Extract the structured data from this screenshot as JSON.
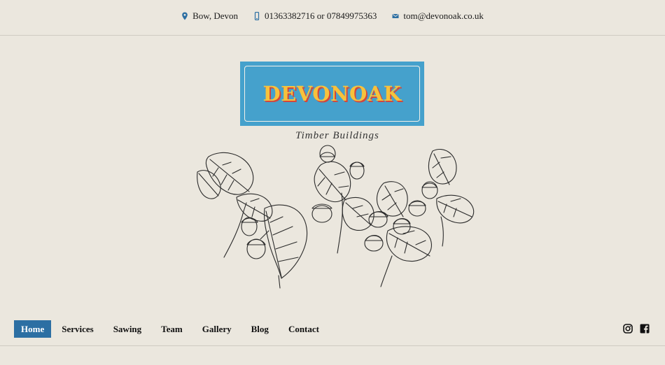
{
  "contact": {
    "location": "Bow, Devon",
    "phones": "01363382716 or 07849975363",
    "email": "tom@devonoak.co.uk",
    "icon_color": "#2c6fa3"
  },
  "logo": {
    "wordmark": "DEVONOAK",
    "tagline": "Timber Buildings",
    "bg_color": "#45a1cc",
    "text_color": "#f6c23c",
    "shadow_color": "#d4453b"
  },
  "nav": {
    "items": [
      {
        "label": "Home",
        "active": true
      },
      {
        "label": "Services"
      },
      {
        "label": "Sawing"
      },
      {
        "label": "Team"
      },
      {
        "label": "Gallery"
      },
      {
        "label": "Blog"
      },
      {
        "label": "Contact"
      }
    ],
    "active_color": "#2c6fa3"
  },
  "social": {
    "icons": [
      "instagram-icon",
      "facebook-icon"
    ]
  }
}
